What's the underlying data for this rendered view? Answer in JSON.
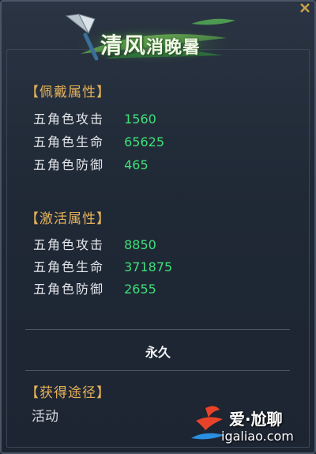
{
  "banner": {
    "title_main": "清风",
    "title_small": "消晚暑"
  },
  "worn_attributes": {
    "title": "【佩戴属性】",
    "stats": [
      {
        "label": "五角色攻击",
        "value": "1560"
      },
      {
        "label": "五角色生命",
        "value": "65625"
      },
      {
        "label": "五角色防御",
        "value": "465"
      }
    ]
  },
  "activation_attributes": {
    "title": "【激活属性】",
    "stats": [
      {
        "label": "五角色攻击",
        "value": "8850"
      },
      {
        "label": "五角色生命",
        "value": "371875"
      },
      {
        "label": "五角色防御",
        "value": "2655"
      }
    ]
  },
  "duration": "永久",
  "acquisition": {
    "title": "【获得途径】",
    "source": "活动"
  },
  "watermark": {
    "name": "爱·尬聊",
    "url": "igaliao.com"
  },
  "colors": {
    "section_title": "#e6b25a",
    "stat_value": "#3fe07a",
    "stat_label": "#e4e6ea"
  }
}
